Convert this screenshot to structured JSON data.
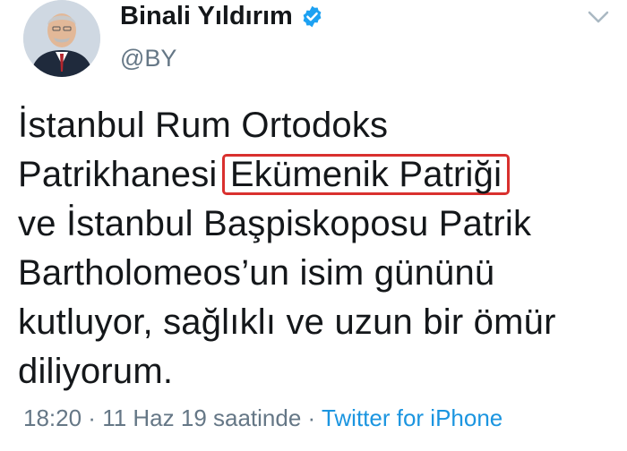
{
  "author": {
    "name": "Binali Yıldırım",
    "handle": "@BY",
    "avatar_icon": "profile-photo",
    "verified_icon": "verified-badge-icon"
  },
  "tweet": {
    "lines": [
      "İstanbul Rum Ortodoks",
      "Patrikhanesi ",
      "ve İstanbul Başpiskoposu Patrik",
      "Bartholomeos’un isim gününü",
      "kutluyor, sağlıklı ve uzun bir ömür",
      "diliyorum."
    ],
    "highlighted_phrase": "Ekümenik Patriği"
  },
  "meta": {
    "time": "18:20",
    "sep1": " · ",
    "date": "11 Haz 19 saatinde",
    "sep2": " · ",
    "source": "Twitter for iPhone"
  },
  "colors": {
    "highlight_border": "#d9302e",
    "link": "#1b95e0",
    "muted": "#657786",
    "verified": "#1da1f2"
  }
}
